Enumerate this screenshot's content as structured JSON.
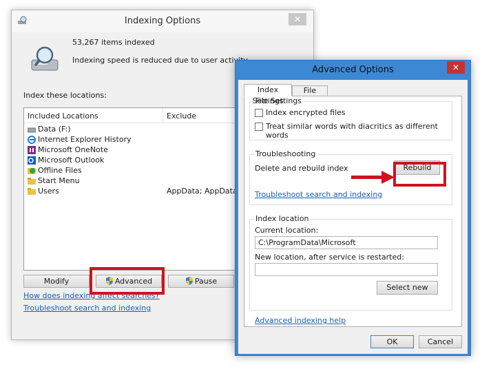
{
  "indexing_window": {
    "title": "Indexing Options",
    "close": "✕",
    "items_indexed": "53,267 items indexed",
    "status": "Indexing speed is reduced due to user activity.",
    "locations_label": "Index these locations:",
    "columns": {
      "included": "Included Locations",
      "exclude": "Exclude"
    },
    "locations": [
      {
        "name": "Data (F:)",
        "exclude": "",
        "icon": "drive-icon"
      },
      {
        "name": "Internet Explorer History",
        "exclude": "",
        "icon": "ie-icon"
      },
      {
        "name": "Microsoft OneNote",
        "exclude": "",
        "icon": "onenote-icon"
      },
      {
        "name": "Microsoft Outlook",
        "exclude": "",
        "icon": "outlook-icon"
      },
      {
        "name": "Offline Files",
        "exclude": "",
        "icon": "offline-files-icon"
      },
      {
        "name": "Start Menu",
        "exclude": "",
        "icon": "folder-icon"
      },
      {
        "name": "Users",
        "exclude": "AppData; AppData",
        "icon": "folder-icon"
      }
    ],
    "buttons": {
      "modify": "Modify",
      "advanced": "Advanced",
      "pause": "Pause"
    },
    "links": {
      "how": "How does indexing affect searches?",
      "troubleshoot": "Troubleshoot search and indexing"
    }
  },
  "advanced_window": {
    "title": "Advanced Options",
    "close": "✕",
    "tabs": [
      "Index Settings",
      "File Types"
    ],
    "file_settings": {
      "title": "File Settings",
      "encrypted": "Index encrypted files",
      "diacritics": "Treat similar words with diacritics as different words",
      "encrypted_checked": false,
      "diacritics_checked": false
    },
    "troubleshooting": {
      "title": "Troubleshooting",
      "delete_label": "Delete and rebuild index",
      "rebuild": "Rebuild",
      "link": "Troubleshoot search and indexing"
    },
    "index_location": {
      "title": "Index location",
      "current_label": "Current location:",
      "current_value": "C:\\ProgramData\\Microsoft",
      "new_label": "New location, after service is restarted:",
      "new_value": "",
      "select_new": "Select new"
    },
    "help_link": "Advanced indexing help",
    "ok": "OK",
    "cancel": "Cancel"
  },
  "colors": {
    "highlight": "#d0121f",
    "title_blue": "#3d88d4",
    "link": "#1a5fb4"
  }
}
